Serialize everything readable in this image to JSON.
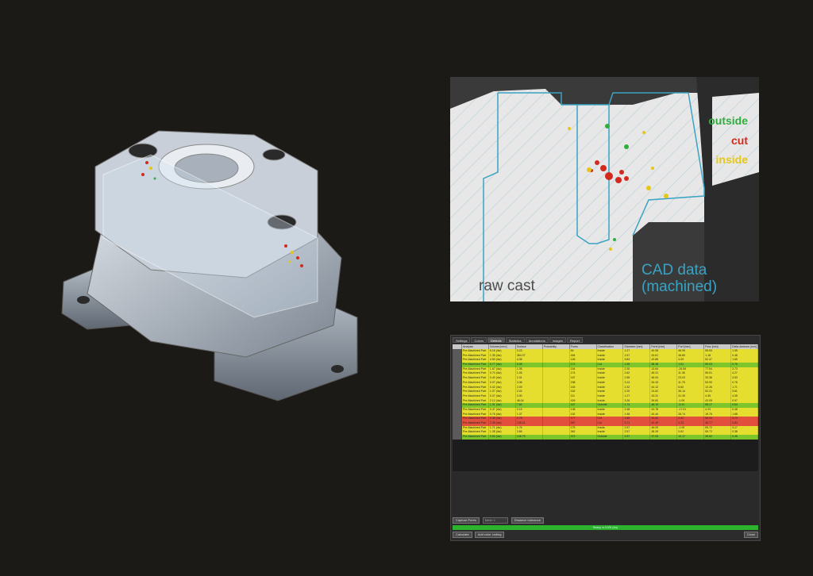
{
  "ct_view": {
    "legend": {
      "outside": "outside",
      "cut": "cut",
      "inside": "inside"
    },
    "colors": {
      "outside": "#2fae3e",
      "cut": "#d42a1e",
      "inside": "#e6c619",
      "cad": "#3aa3c3"
    },
    "label_raw": "raw cast",
    "label_cad_line1": "CAD data",
    "label_cad_line2": "(machined)"
  },
  "app": {
    "tabs": [
      "Settings",
      "Colors",
      "Defects",
      "Statistics",
      "Annotations",
      "Images",
      "Report"
    ],
    "active_tab": "Defects",
    "columns": [
      "",
      "Analysis",
      "Volume [mm³]",
      "Surface",
      "Probability",
      "Pores",
      "Classification",
      "Diameter [mm]",
      "Feret [mm]",
      "Porf [mm]",
      "Pxsz [mm]",
      "Delta distance [mm]"
    ],
    "rows": [
      {
        "values": [
          "",
          "Pre-Machined Part",
          "6.16 (4w)",
          "3.23",
          "",
          "84",
          "Inside",
          "1.27",
          "40.08",
          "46.99",
          "55.53",
          "1.35"
        ],
        "status": "inside"
      },
      {
        "values": [
          "",
          "Pre-Machined Part",
          "1.35 (4w)",
          "384.37",
          "",
          "454",
          "Inside",
          "2.57",
          "43.61",
          "46.89",
          "1.18",
          "0.48"
        ],
        "status": "inside"
      },
      {
        "values": [
          "",
          "Pre-Machined Part",
          "4.50 (4w)",
          "4.35",
          "",
          "146",
          "Inside",
          "3.84",
          "43.88",
          "4.09",
          "52.47",
          "1.65"
        ],
        "status": "inside"
      },
      {
        "values": [
          "",
          "Pre-Machined Part",
          "0.77 (4w)",
          "0.35",
          "",
          "172",
          "Cut",
          "1.06",
          "38.38",
          "1.51",
          "59.03",
          "0.76"
        ],
        "status": "outside"
      },
      {
        "values": [
          "",
          "Pre-Machined Part",
          "1.67 (4w)",
          "1.35",
          "",
          "154",
          "Inside",
          "2.30",
          "13.64",
          "-26.56",
          "77.54",
          "3.73"
        ],
        "status": "inside"
      },
      {
        "values": [
          "",
          "Pre-Machined Part",
          "0.70 (4w)",
          "1.26",
          "",
          "174",
          "Inside",
          "2.62",
          "45.31",
          "11.36",
          "55.01",
          "4.27"
        ],
        "status": "inside"
      },
      {
        "values": [
          "",
          "Pre-Machined Part",
          "0.40 (4w)",
          "2.31",
          "",
          "167",
          "Inside",
          "2.55",
          "46.04",
          "23.03",
          "33.36",
          "3.53"
        ],
        "status": "inside"
      },
      {
        "values": [
          "",
          "Pre-Machined Part",
          "0.07 (4w)",
          "3.36",
          "",
          "158",
          "Inside",
          "3.14",
          "34.43",
          "11.75",
          "53.90",
          "0.76"
        ],
        "status": "inside"
      },
      {
        "values": [
          "",
          "Pre-Machined Part",
          "0.42 (4w)",
          "2.09",
          "",
          "163",
          "Inside",
          "2.32",
          "44.12",
          "6.60",
          "12.26",
          "1.71"
        ],
        "status": "inside"
      },
      {
        "values": [
          "",
          "Pre-Machined Part",
          "1.07 (4w)",
          "2.04",
          "",
          "162",
          "Inside",
          "2.20",
          "24.62",
          "36.14",
          "52.21",
          "3.61"
        ],
        "status": "inside"
      },
      {
        "values": [
          "",
          "Pre-Machined Part",
          "0.37 (4w)",
          "3.30",
          "",
          "111",
          "Inside",
          "1.27",
          "43.31",
          "31.39",
          "4.35",
          "4.35"
        ],
        "status": "inside"
      },
      {
        "values": [
          "",
          "Pre-Machined Part",
          "2.12 (4w)",
          "46.04",
          "",
          "426",
          "Inside",
          "3.26",
          "39.60",
          "-1.09",
          "43.05",
          "0.97"
        ],
        "status": "inside"
      },
      {
        "values": [
          "",
          "Pre-Machined Part",
          "1.31 (4w)",
          "7.62",
          "",
          "167",
          "Outside",
          "1.74",
          "46.19",
          "-3.41",
          "58.17",
          "0.64"
        ],
        "status": "outside"
      },
      {
        "values": [
          "",
          "Pre-Machined Part",
          "0.47 (4w)",
          "2.15",
          "",
          "138",
          "Inside",
          "2.48",
          "44.78",
          "-17.01",
          "4.23",
          "0.48"
        ],
        "status": "inside"
      },
      {
        "values": [
          "",
          "Pre-Machined Part",
          "0.76 (4w)",
          "1.37",
          "",
          "152",
          "Inside",
          "2.48",
          "43.44",
          "26.74",
          "15.76",
          "1.68"
        ],
        "status": "inside"
      },
      {
        "values": [
          "",
          "Pre-Machined Part",
          "0.35 (4w)",
          "2.78",
          "",
          "177",
          "Cut",
          "3.46",
          "34.62",
          "2.42",
          "56.34",
          "3.73"
        ],
        "status": "cut"
      },
      {
        "values": [
          "",
          "Pre-Machined Part",
          "2.95 (4w)",
          "138.31",
          "",
          "367",
          "Cut",
          "3.71",
          "42.49",
          "3.23",
          "35.77",
          "0.83"
        ],
        "status": "cut"
      },
      {
        "values": [
          "",
          "Pre-Machined Part",
          "1.71 (4w)",
          "1.76",
          "",
          "175",
          "Inside",
          "2.57",
          "46.09",
          "-1.09",
          "55.72",
          "3.17"
        ],
        "status": "inside"
      },
      {
        "values": [
          "",
          "Pre-Machined Part",
          "1.35 (4w)",
          "3.85",
          "",
          "362",
          "Inside",
          "2.57",
          "38.25",
          "0.62",
          "55.72",
          "0.38"
        ],
        "status": "inside"
      },
      {
        "values": [
          "",
          "Pre-Machined Part",
          "0.63 (4w)",
          "136.75",
          "",
          "372",
          "Outside",
          "2.57",
          "37.03",
          "10.17",
          "35.52",
          "0.45"
        ],
        "status": "outside"
      }
    ],
    "status_colors": {
      "inside": "#e5de2e",
      "outside": "#7cc62c",
      "cut": "#e2503d"
    },
    "capture_button": "Capture Pores",
    "mesh_label": "Mesh 1",
    "distance_label": "Distance tolerance",
    "progress_text": "Ready in 0.000 (4w)",
    "calculate_button": "Calculate",
    "color_coding_button": "Add color coding",
    "close_button": "Close"
  }
}
